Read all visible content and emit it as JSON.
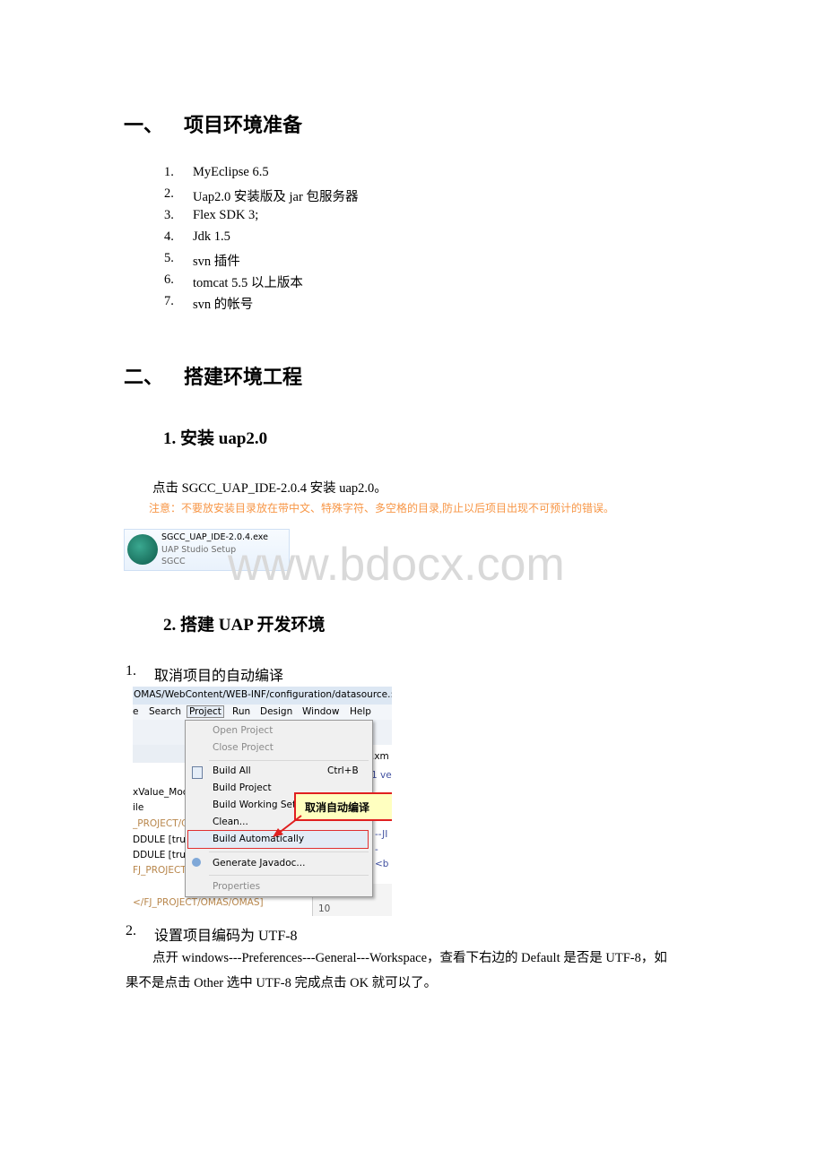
{
  "section1": {
    "num": "一、",
    "title": "项目环境准备",
    "items": [
      {
        "n": "1.",
        "t": "MyEclipse 6.5"
      },
      {
        "n": "2.",
        "t": "Uap2.0 安装版及 jar 包服务器"
      },
      {
        "n": "3.",
        "t": "Flex SDK 3;"
      },
      {
        "n": "4.",
        "t": "Jdk 1.5"
      },
      {
        "n": "5.",
        "t": "svn 插件"
      },
      {
        "n": "6.",
        "t": "tomcat 5.5  以上版本"
      },
      {
        "n": "7.",
        "t": "svn 的帐号"
      }
    ]
  },
  "section2": {
    "num": "二、",
    "title": "搭建环境工程",
    "sub1": {
      "title": "1.  安装 uap2.0",
      "para": "点击 SGCC_UAP_IDE-2.0.4 安装 uap2.0。",
      "note": "注意：不要放安装目录放在带中文、特殊字符、多空格的目录,防止以后项目出现不可预计的错误。",
      "exe": {
        "name": "SGCC_UAP_IDE-2.0.4.exe",
        "desc": "UAP Studio Setup",
        "company": "SGCC"
      }
    },
    "sub2": {
      "title": "2.  搭建 UAP 开发环境",
      "step1": {
        "n": "1.",
        "t": "取消项目的自动编译"
      },
      "screenshot": {
        "path": "OMAS/WebContent/WEB-INF/configuration/datasource.:",
        "menubar": [
          "e",
          "Search",
          "Project",
          "Run",
          "Design",
          "Window",
          "Help"
        ],
        "menu": {
          "open": "Open Project",
          "close": "Close Project",
          "build_all": "Build All",
          "shortcut": "Ctrl+B",
          "build_project": "Build Project",
          "build_ws": "Build Working Set",
          "clean": "Clean...",
          "build_auto": "Build Automatically",
          "javadoc": "Generate Javadoc...",
          "properties": "Properties"
        },
        "callout": "取消自动编译",
        "left": [
          "xValue_Moc",
          "ile",
          "_PROJECT/C",
          "DDULE [trur",
          "DDULE [trur",
          "FJ_PROJECT",
          "</FJ_PROJECT/OMAS/OMAS]"
        ],
        "right": [
          ".xm",
          "1  ve",
          "--JI",
          "-",
          "<b",
          "10"
        ]
      },
      "step2": {
        "n": "2.",
        "t": "设置项目编码为 UTF-8"
      },
      "para1": "点开 windows---Preferences---General---Workspace，查看下右边的 Default 是否是 UTF-8，如",
      "para2": "果不是点击 Other 选中 UTF-8 完成点击 OK 就可以了。"
    }
  },
  "watermark": "www.bdocx.com",
  "colors": {
    "note": "#f79646",
    "callout_bg": "#ffffc0",
    "callout_border": "#e02020"
  }
}
